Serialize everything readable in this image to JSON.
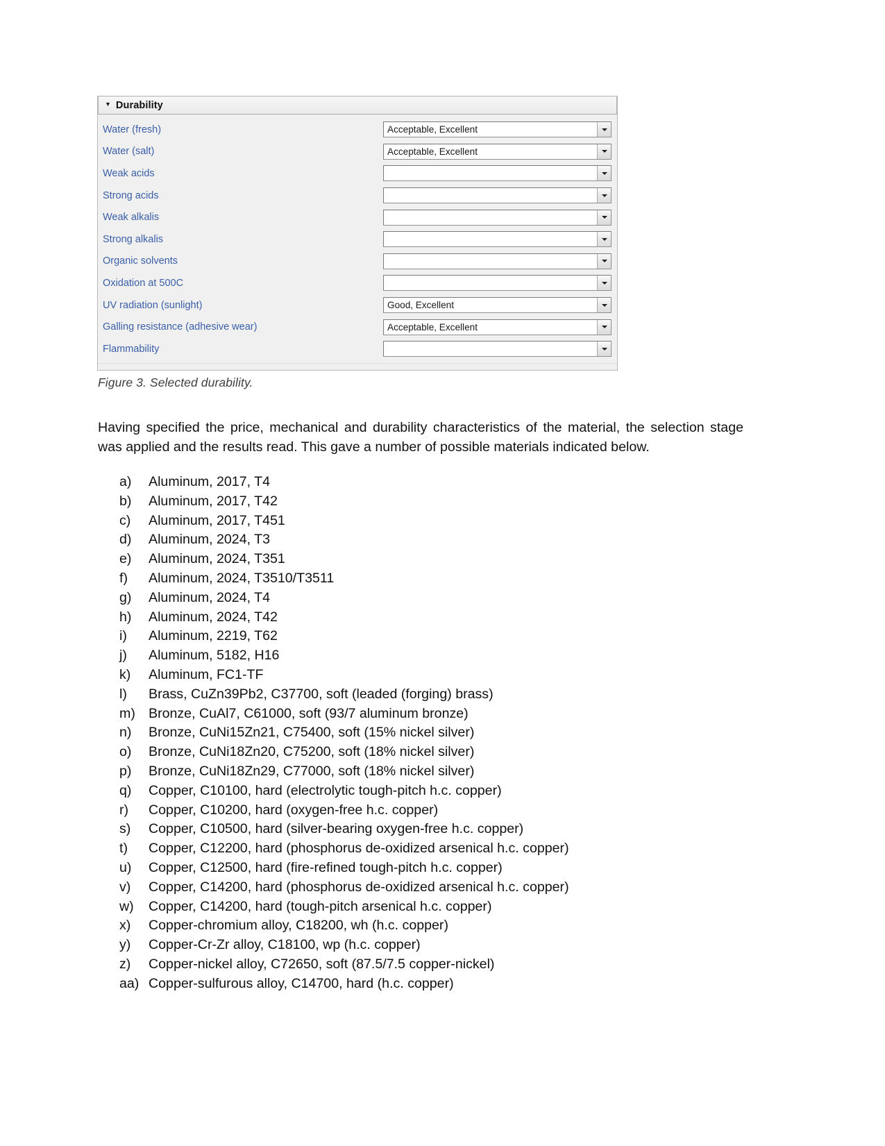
{
  "figure": {
    "panel": {
      "title": "Durability",
      "twisty_icon": "triangle-down-icon",
      "rows": [
        {
          "label": "Water (fresh)",
          "value": "Acceptable, Excellent"
        },
        {
          "label": "Water (salt)",
          "value": "Acceptable, Excellent"
        },
        {
          "label": "Weak acids",
          "value": ""
        },
        {
          "label": "Strong acids",
          "value": ""
        },
        {
          "label": "Weak alkalis",
          "value": ""
        },
        {
          "label": "Strong alkalis",
          "value": ""
        },
        {
          "label": "Organic solvents",
          "value": ""
        },
        {
          "label": "Oxidation at 500C",
          "value": ""
        },
        {
          "label": "UV radiation (sunlight)",
          "value": "Good, Excellent"
        },
        {
          "label": "Galling resistance (adhesive wear)",
          "value": "Acceptable, Excellent"
        },
        {
          "label": "Flammability",
          "value": ""
        }
      ],
      "dropdown_icon": "chevron-down-icon"
    },
    "caption": "Figure 3. Selected durability."
  },
  "body": {
    "paragraph": "Having specified the price, mechanical and durability characteristics of the material, the selection stage was applied and the results read. This gave a number of possible materials indicated below."
  },
  "materials_list": [
    {
      "marker": "a)",
      "text": "Aluminum, 2017, T4"
    },
    {
      "marker": "b)",
      "text": "Aluminum, 2017, T42"
    },
    {
      "marker": "c)",
      "text": "Aluminum, 2017, T451"
    },
    {
      "marker": "d)",
      "text": "Aluminum, 2024, T3"
    },
    {
      "marker": "e)",
      "text": "Aluminum, 2024, T351"
    },
    {
      "marker": "f)",
      "text": "Aluminum, 2024, T3510/T3511"
    },
    {
      "marker": "g)",
      "text": "Aluminum, 2024, T4"
    },
    {
      "marker": "h)",
      "text": "Aluminum, 2024, T42"
    },
    {
      "marker": "i)",
      "text": "Aluminum, 2219, T62"
    },
    {
      "marker": "j)",
      "text": "Aluminum, 5182, H16"
    },
    {
      "marker": "k)",
      "text": "Aluminum, FC1-TF"
    },
    {
      "marker": "l)",
      "text": "Brass, CuZn39Pb2, C37700, soft (leaded (forging) brass)"
    },
    {
      "marker": "m)",
      "text": "Bronze, CuAl7, C61000, soft (93/7 aluminum bronze)"
    },
    {
      "marker": "n)",
      "text": "Bronze, CuNi15Zn21, C75400, soft (15% nickel silver)"
    },
    {
      "marker": "o)",
      "text": "Bronze, CuNi18Zn20, C75200, soft (18% nickel silver)"
    },
    {
      "marker": "p)",
      "text": "Bronze, CuNi18Zn29, C77000, soft (18% nickel silver)"
    },
    {
      "marker": "q)",
      "text": "Copper, C10100, hard (electrolytic tough-pitch h.c. copper)"
    },
    {
      "marker": "r)",
      "text": "Copper, C10200, hard (oxygen-free h.c. copper)"
    },
    {
      "marker": "s)",
      "text": "Copper, C10500, hard (silver-bearing oxygen-free h.c. copper)"
    },
    {
      "marker": "t)",
      "text": "Copper, C12200, hard (phosphorus de-oxidized arsenical h.c. copper)"
    },
    {
      "marker": "u)",
      "text": "Copper, C12500, hard (fire-refined tough-pitch h.c. copper)"
    },
    {
      "marker": "v)",
      "text": "Copper, C14200, hard (phosphorus de-oxidized arsenical h.c. copper)"
    },
    {
      "marker": "w)",
      "text": "Copper, C14200, hard (tough-pitch arsenical h.c. copper)"
    },
    {
      "marker": "x)",
      "text": "Copper-chromium alloy, C18200, wh (h.c. copper)"
    },
    {
      "marker": "y)",
      "text": "Copper-Cr-Zr alloy, C18100, wp (h.c. copper)"
    },
    {
      "marker": "z)",
      "text": "Copper-nickel alloy, C72650, soft (87.5/7.5 copper-nickel)"
    },
    {
      "marker": "aa)",
      "text": "Copper-sulfurous alloy, C14700, hard (h.c. copper)"
    }
  ],
  "colors": {
    "label_blue": "#3a5fa8",
    "panel_bg": "#f0f0f0",
    "text_black": "#111111",
    "caption_gray": "#3f3f3f"
  }
}
